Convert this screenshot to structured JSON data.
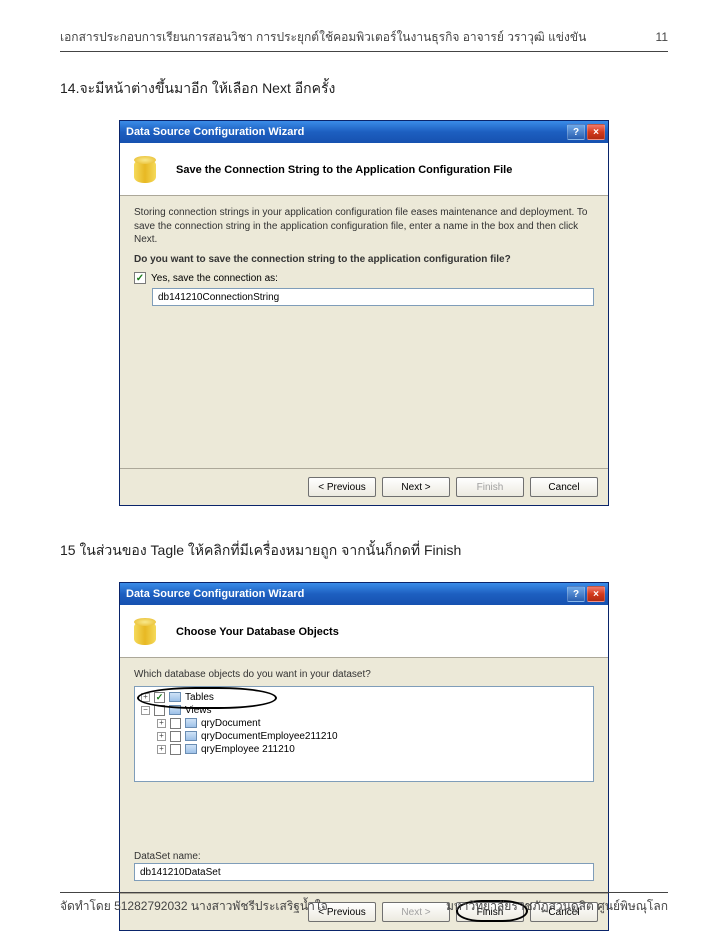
{
  "header": {
    "left": "เอกสารประกอบการเรียนการสอนวิชา การประยุกต์ใช้คอมพิวเตอร์ในงานธุรกิจ อาจารย์ วราวุฒิ แข่งขัน",
    "page": "11"
  },
  "step14": "14.จะมีหน้าต่างขึ้นมาอีก ให้เลือก Next  อีกครั้ง",
  "step15": "15 ในส่วนของ Tagle ให้คลิกที่มีเครื่องหมายถูก จากนั้นก็กดที่ Finish",
  "dlg1": {
    "title": "Data Source Configuration Wizard",
    "heading": "Save the Connection String to the Application Configuration File",
    "desc": "Storing connection strings in your application configuration file eases maintenance and deployment. To save the connection string in the application configuration file, enter a name in the box and then click Next.",
    "question": "Do you want to save the connection string to the application configuration file?",
    "check_label": "Yes, save the connection as:",
    "field_value": "db141210ConnectionString",
    "btn_prev": "< Previous",
    "btn_next": "Next >",
    "btn_finish": "Finish",
    "btn_cancel": "Cancel"
  },
  "dlg2": {
    "title": "Data Source Configuration Wizard",
    "heading": "Choose Your Database Objects",
    "question": "Which database objects do you want in your dataset?",
    "tree": {
      "tables": "Tables",
      "views": "Views",
      "v1": "qryDocument",
      "v2": "qryDocumentEmployee211210",
      "v3": "qryEmployee 211210"
    },
    "ds_label": "DataSet name:",
    "ds_value": "db141210DataSet",
    "btn_prev": "< Previous",
    "btn_next": "Next >",
    "btn_finish": "Finish",
    "btn_cancel": "Cancel"
  },
  "footer": {
    "left": "จัดทำโดย 51282792032 นางสาวพัชรีประเสริฐน้ำใจ",
    "right": "มหาวิทยาลัยราชภัฏสวนดุสิต ศูนย์พิษณุโลก"
  }
}
